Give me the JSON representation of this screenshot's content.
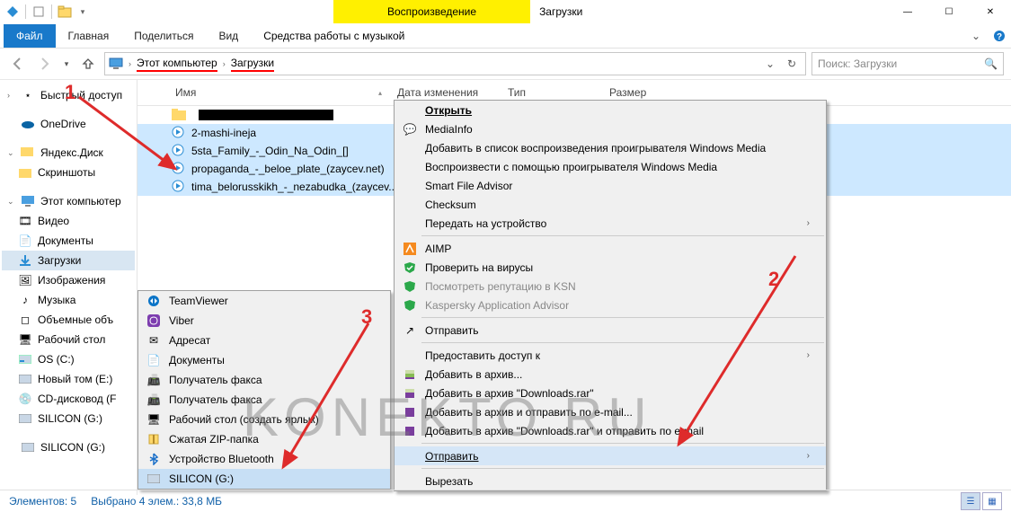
{
  "window": {
    "contextTab": "Воспроизведение",
    "title": "Загрузки"
  },
  "ribbon": {
    "file": "Файл",
    "tabs": [
      "Главная",
      "Поделиться",
      "Вид"
    ],
    "contextTab": "Средства работы с музыкой"
  },
  "address": {
    "crumbs": [
      "Этот компьютер",
      "Загрузки"
    ],
    "searchPlaceholder": "Поиск: Загрузки"
  },
  "sidebar": {
    "quick": "Быстрый доступ",
    "onedrive": "OneDrive",
    "yadisk": "Яндекс.Диск",
    "screenshots": "Скриншоты",
    "thispc": "Этот компьютер",
    "children": [
      "Видео",
      "Документы",
      "Загрузки",
      "Изображения",
      "Музыка",
      "Объемные объ",
      "Рабочий стол",
      "OS (C:)",
      "Новый том (E:)",
      "CD-дисковод (F",
      "SILICON (G:)"
    ],
    "drive2": "SILICON (G:)"
  },
  "columns": {
    "name": "Имя",
    "date": "Дата изменения",
    "type": "Тип",
    "size": "Размер"
  },
  "files": [
    {
      "name": "2-mashi-ineja"
    },
    {
      "name": "5sta_Family_-_Odin_Na_Odin_[]"
    },
    {
      "name": "propaganda_-_beloe_plate_(zaycev.net)"
    },
    {
      "name": "tima_belorusskikh_-_nezabudka_(zaycev..."
    }
  ],
  "sendto": {
    "items": [
      "TeamViewer",
      "Viber",
      "Адресат",
      "Документы",
      "Получатель факса",
      "Получатель факса",
      "Рабочий стол (создать ярлык)",
      "Сжатая ZIP-папка",
      "Устройство Bluetooth",
      "SILICON (G:)"
    ]
  },
  "ctx": {
    "open": "Открыть",
    "mediainfo": "MediaInfo",
    "addPlaylist": "Добавить в список воспроизведения проигрывателя Windows Media",
    "playWmp": "Воспроизвести с помощью проигрывателя Windows Media",
    "sfa": "Smart File Advisor",
    "checksum": "Checksum",
    "castTo": "Передать на устройство",
    "aimp": "AIMP",
    "scan": "Проверить на вирусы",
    "ksn": "Посмотреть репутацию в KSN",
    "kaa": "Kaspersky Application Advisor",
    "share": "Отправить",
    "giveAccess": "Предоставить доступ к",
    "addArchive": "Добавить в архив...",
    "addDl": "Добавить в архив \"Downloads.rar\"",
    "addEmail": "Добавить в архив и отправить по e-mail...",
    "addDlEmail": "Добавить в архив \"Downloads.rar\" и отправить по e-mail",
    "sendTo": "Отправить",
    "cut": "Вырезать"
  },
  "status": {
    "items": "Элементов: 5",
    "selected": "Выбрано 4 элем.: 33,8 МБ"
  },
  "annotations": {
    "a1": "1",
    "a2": "2",
    "a3": "3",
    "watermark": "KONEKTO  RU"
  }
}
